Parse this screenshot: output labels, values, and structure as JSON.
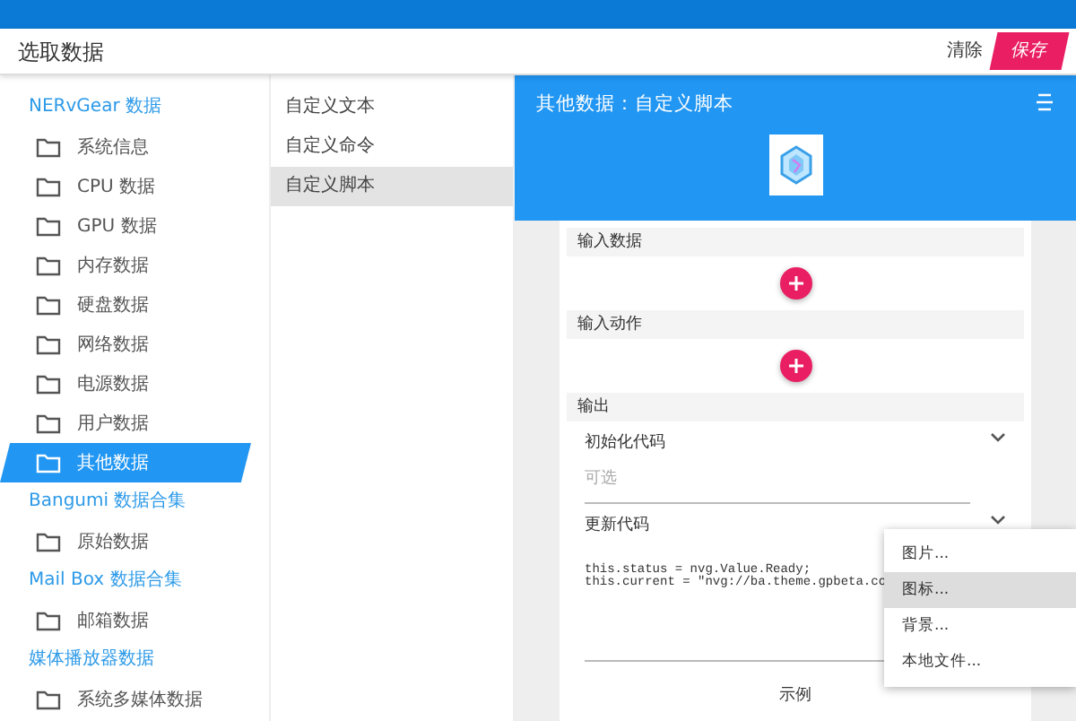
{
  "window": {
    "title": "选取数据"
  },
  "header_buttons": [
    {
      "label": "清除",
      "kind": "text"
    },
    {
      "label": "保存",
      "kind": "primary"
    }
  ],
  "sidebar": {
    "groups": [
      {
        "label": "NERvGear 数据",
        "items": [
          {
            "label": "系统信息",
            "selected": false
          },
          {
            "label": "CPU 数据",
            "selected": false
          },
          {
            "label": "GPU 数据",
            "selected": false
          },
          {
            "label": "内存数据",
            "selected": false
          },
          {
            "label": "硬盘数据",
            "selected": false
          },
          {
            "label": "网络数据",
            "selected": false
          },
          {
            "label": "电源数据",
            "selected": false
          },
          {
            "label": "用户数据",
            "selected": false
          },
          {
            "label": "其他数据",
            "selected": true
          }
        ]
      },
      {
        "label": "Bangumi 数据合集",
        "items": [
          {
            "label": "原始数据",
            "selected": false
          }
        ]
      },
      {
        "label": "Mail Box 数据合集",
        "items": [
          {
            "label": "邮箱数据",
            "selected": false
          }
        ]
      },
      {
        "label": "媒体播放器数据",
        "items": [
          {
            "label": "系统多媒体数据",
            "selected": false
          }
        ]
      }
    ]
  },
  "subtypes": [
    {
      "label": "自定义文本",
      "selected": false
    },
    {
      "label": "自定义命令",
      "selected": false
    },
    {
      "label": "自定义脚本",
      "selected": true
    }
  ],
  "detail": {
    "title": "其他数据：自定义脚本",
    "sections": [
      {
        "label": "输入数据",
        "kind": "add"
      },
      {
        "label": "输入动作",
        "kind": "add"
      },
      {
        "label": "输出",
        "kind": "output"
      }
    ],
    "output_fields": [
      {
        "label": "初始化代码",
        "placeholder": "可选"
      },
      {
        "label": "更新代码",
        "code": [
          "this.status = nvg.Value.Ready;",
          "this.current = \"nvg://ba.theme.gpbeta.co"
        ]
      }
    ],
    "example_button": "示例"
  },
  "context_menu": [
    {
      "label": "图片...",
      "selected": false
    },
    {
      "label": "图标...",
      "selected": true
    },
    {
      "label": "背景...",
      "selected": false
    },
    {
      "label": "本地文件...",
      "selected": false
    }
  ]
}
